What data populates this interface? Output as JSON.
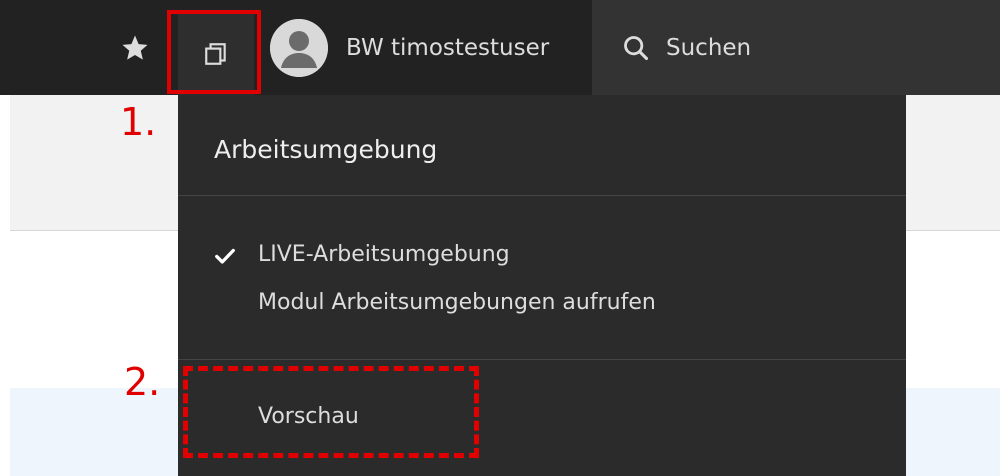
{
  "toolbar": {
    "user_name": "BW timostestuser",
    "search_label": "Suchen"
  },
  "dropdown": {
    "header": "Arbeitsumgebung",
    "items": [
      {
        "label": "LIVE-Arbeitsumgebung",
        "checked": true
      },
      {
        "label": "Modul Arbeitsumgebungen aufrufen"
      }
    ],
    "preview_label": "Vorschau"
  },
  "annotations": {
    "step1": "1.",
    "step2": "2."
  },
  "colors": {
    "toolbar_bg": "#222222",
    "dropdown_bg": "#2b2b2b",
    "annotation_red": "#e00000"
  },
  "icons": [
    "star-icon",
    "workspaces-icon",
    "user-avatar-icon",
    "search-icon",
    "checkmark-icon"
  ]
}
